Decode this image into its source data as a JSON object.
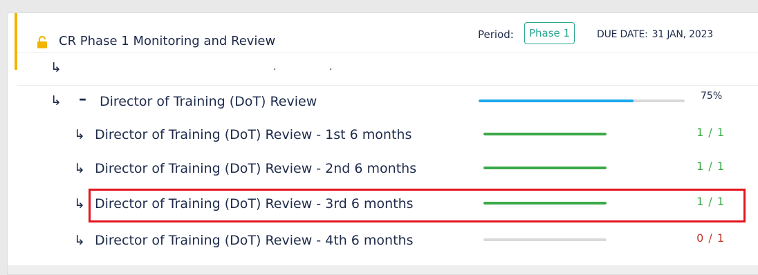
{
  "header": {
    "title": "CR Phase 1 Monitoring and Review",
    "period_label": "Period:",
    "period_value": "Phase 1",
    "due_label": "DUE DATE:",
    "due_value": "31 JAN, 2023",
    "lock_icon": "lock-open-icon",
    "accent_color": "#f3b400"
  },
  "parent": {
    "label": "Director of Training (DoT) Review",
    "progress_percent": 75,
    "progress_text": "75%",
    "progress_color": "#1aa7ec"
  },
  "children": [
    {
      "label": "Director of Training (DoT) Review - 1st 6 months",
      "count": "1 / 1",
      "progress": 1,
      "status_color": "#3aaa48"
    },
    {
      "label": "Director of Training (DoT) Review - 2nd 6 months",
      "count": "1 / 1",
      "progress": 1,
      "status_color": "#3aaa48"
    },
    {
      "label": "Director of Training (DoT) Review - 3rd 6 months",
      "count": "1 / 1",
      "progress": 1,
      "status_color": "#3aaa48",
      "highlighted": true
    },
    {
      "label": "Director of Training (DoT) Review - 4th 6 months",
      "count": "0 / 1",
      "progress": 0,
      "status_color": "#c0392b"
    }
  ],
  "colors": {
    "text": "#1d2a4a",
    "teal": "#2aa78f",
    "highlight": "#e3141c",
    "track": "#d9d9d9"
  }
}
